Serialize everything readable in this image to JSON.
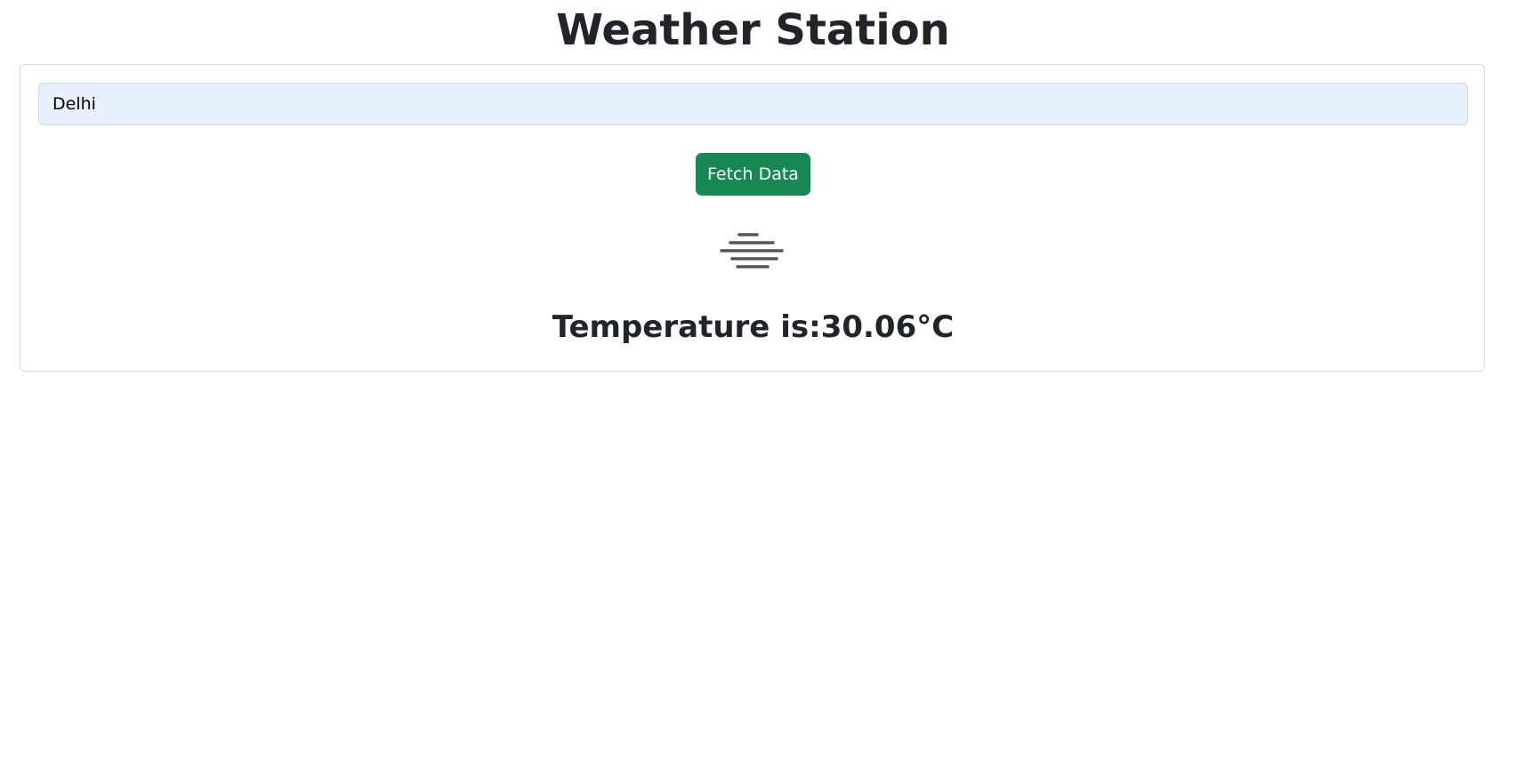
{
  "header": {
    "title": "Weather Station"
  },
  "search": {
    "value": "Delhi",
    "placeholder": ""
  },
  "actions": {
    "fetch_label": "Fetch Data"
  },
  "weather": {
    "icon": "mist-icon",
    "temperature_label": "Temperature is:",
    "temperature_value": "30.06",
    "temperature_unit": "°C"
  },
  "colors": {
    "accent": "#198754",
    "input_background": "#e8f0fe",
    "text": "#212529",
    "icon": "#555555"
  }
}
